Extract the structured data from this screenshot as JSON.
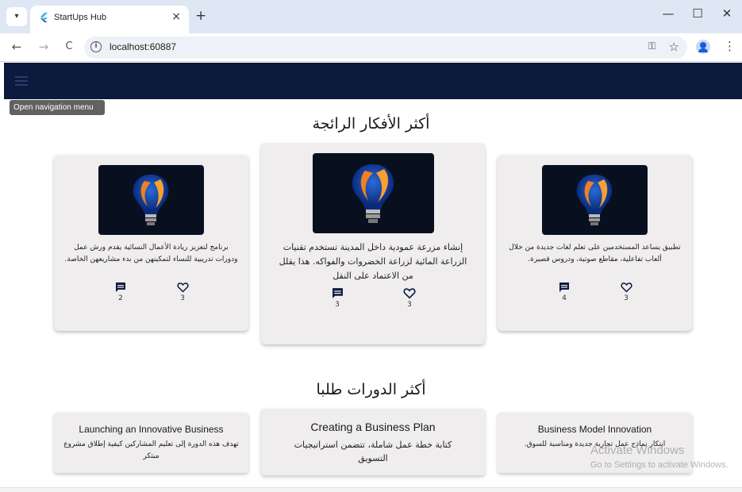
{
  "browser": {
    "tab_title": "StartUps Hub",
    "tab_close": "×",
    "new_tab": "+",
    "url": "localhost:60887",
    "controls": {
      "minimize": "—",
      "maximize": "☐",
      "close": "✕"
    },
    "nav": {
      "back": "←",
      "forward": "→",
      "reload": "C"
    },
    "icons": [
      "dropdown-icon",
      "flutter-favicon",
      "info-icon",
      "key-icon",
      "star-icon",
      "profile-icon",
      "kebab-menu-icon"
    ]
  },
  "app": {
    "tooltip": "Open navigation menu",
    "colors": {
      "appbar": "#0c1a3e",
      "card": "#efedee"
    }
  },
  "ideas": {
    "title": "أكثر الأفكار الرائجة",
    "cards": [
      {
        "text": "برنامج لتعزيز ريادة الأعمال النسائية يقدم ورش عمل ودورات تدريبية للنساء لتمكينهن من بدء مشاريعهن الخاصة.",
        "comments": "2",
        "likes": "3"
      },
      {
        "text": "إنشاء مزرعة عمودية داخل المدينة تستخدم تقنيات الزراعة المائية لزراعة الخضروات والفواكه. هذا يقلل من الاعتماد على النقل",
        "comments": "3",
        "likes": "3"
      },
      {
        "text": "تطبيق يساعد المستخدمين على تعلم لغات جديدة من خلال ألعاب تفاعلية، مقاطع صوتية، ودروس قصيرة.",
        "comments": "4",
        "likes": "3"
      }
    ]
  },
  "courses": {
    "title": "أكثر الدورات طلبا",
    "cards": [
      {
        "title": "Launching an Innovative Business",
        "desc": "تهدف هذه الدورة إلى تعليم المشاركين كيفية إطلاق مشروع مبتكر"
      },
      {
        "title": "Creating a Business Plan",
        "desc": "كتابة خطة عمل شاملة، تتضمن استراتيجيات التسويق"
      },
      {
        "title": "Business Model Innovation",
        "desc": "ابتكار نماذج عمل تجارية جديدة ومناسبة للسوق."
      }
    ]
  },
  "watermark": {
    "line1": "Activate Windows",
    "line2": "Go to Settings to activate Windows."
  }
}
